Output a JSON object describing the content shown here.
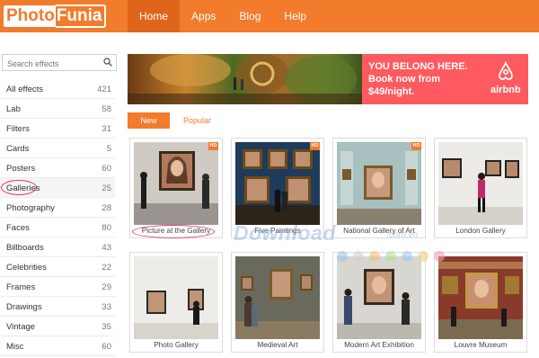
{
  "logo": {
    "part1": "Photo",
    "part2": "Funia"
  },
  "nav": {
    "home": "Home",
    "apps": "Apps",
    "blog": "Blog",
    "help": "Help"
  },
  "search": {
    "placeholder": "Search effects"
  },
  "categories": [
    {
      "label": "All effects",
      "count": "421"
    },
    {
      "label": "Lab",
      "count": "58"
    },
    {
      "label": "Filters",
      "count": "31"
    },
    {
      "label": "Cards",
      "count": "5"
    },
    {
      "label": "Posters",
      "count": "60"
    },
    {
      "label": "Galleries",
      "count": "25"
    },
    {
      "label": "Photography",
      "count": "28"
    },
    {
      "label": "Faces",
      "count": "80"
    },
    {
      "label": "Billboards",
      "count": "43"
    },
    {
      "label": "Celebrities",
      "count": "22"
    },
    {
      "label": "Frames",
      "count": "29"
    },
    {
      "label": "Drawings",
      "count": "33"
    },
    {
      "label": "Vintage",
      "count": "35"
    },
    {
      "label": "Misc",
      "count": "60"
    }
  ],
  "ad": {
    "line1": "YOU BELONG HERE.",
    "line2": "Book now from",
    "line3": "$49/night.",
    "brand": "airbnb"
  },
  "tabs": {
    "new": "New",
    "popular": "Popular"
  },
  "hd_badge": "HD",
  "effects": [
    {
      "title": "Picture at the Gallery",
      "hd": true
    },
    {
      "title": "Five Paintings",
      "hd": true
    },
    {
      "title": "National Gallery of Art",
      "hd": true
    },
    {
      "title": "London Gallery",
      "hd": false
    },
    {
      "title": "Photo Gallery",
      "hd": false
    },
    {
      "title": "Medieval Art",
      "hd": false
    },
    {
      "title": "Modern Art Exhibition",
      "hd": false
    },
    {
      "title": "Louvre Museum",
      "hd": false
    }
  ],
  "watermark": {
    "text": "Download",
    "domain": ".com.vn"
  },
  "colors": {
    "brand": "#f27b2c",
    "airbnb": "#ff5a5f",
    "highlight_ring": "#e33a6d"
  }
}
